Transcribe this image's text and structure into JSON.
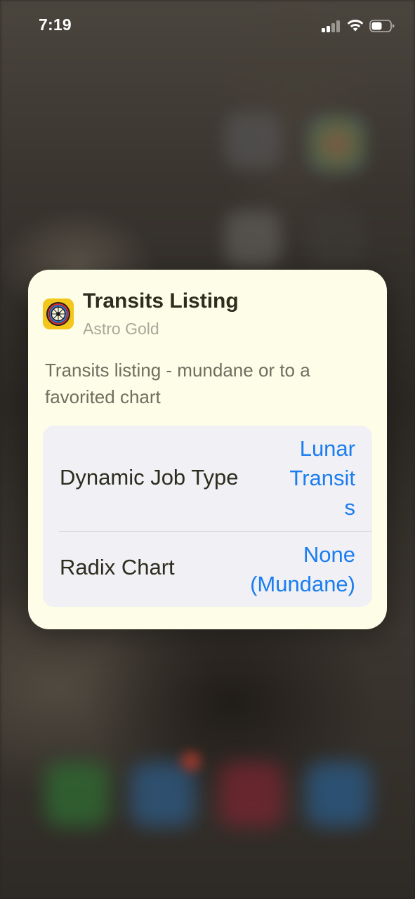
{
  "status_bar": {
    "time": "7:19"
  },
  "card": {
    "app_icon": "astro-gold-wheel-icon",
    "title": "Transits Listing",
    "subtitle": "Astro Gold",
    "description": "Transits listing - mundane or to a favorited chart",
    "parameters": [
      {
        "label": "Dynamic Job Type",
        "value_lines": [
          "Lunar",
          "Transit",
          "s"
        ]
      },
      {
        "label": "Radix Chart",
        "value_lines": [
          "None",
          "(Mundane)"
        ]
      }
    ]
  },
  "colors": {
    "card_background": "#fefde8",
    "parameter_background": "#f0f0f5",
    "accent_link": "#1a7df0",
    "title_text": "#2d2c1f",
    "subtitle_text": "#a9a89a",
    "description_text": "#6f6e60",
    "icon_yellow": "#f3c61b"
  }
}
